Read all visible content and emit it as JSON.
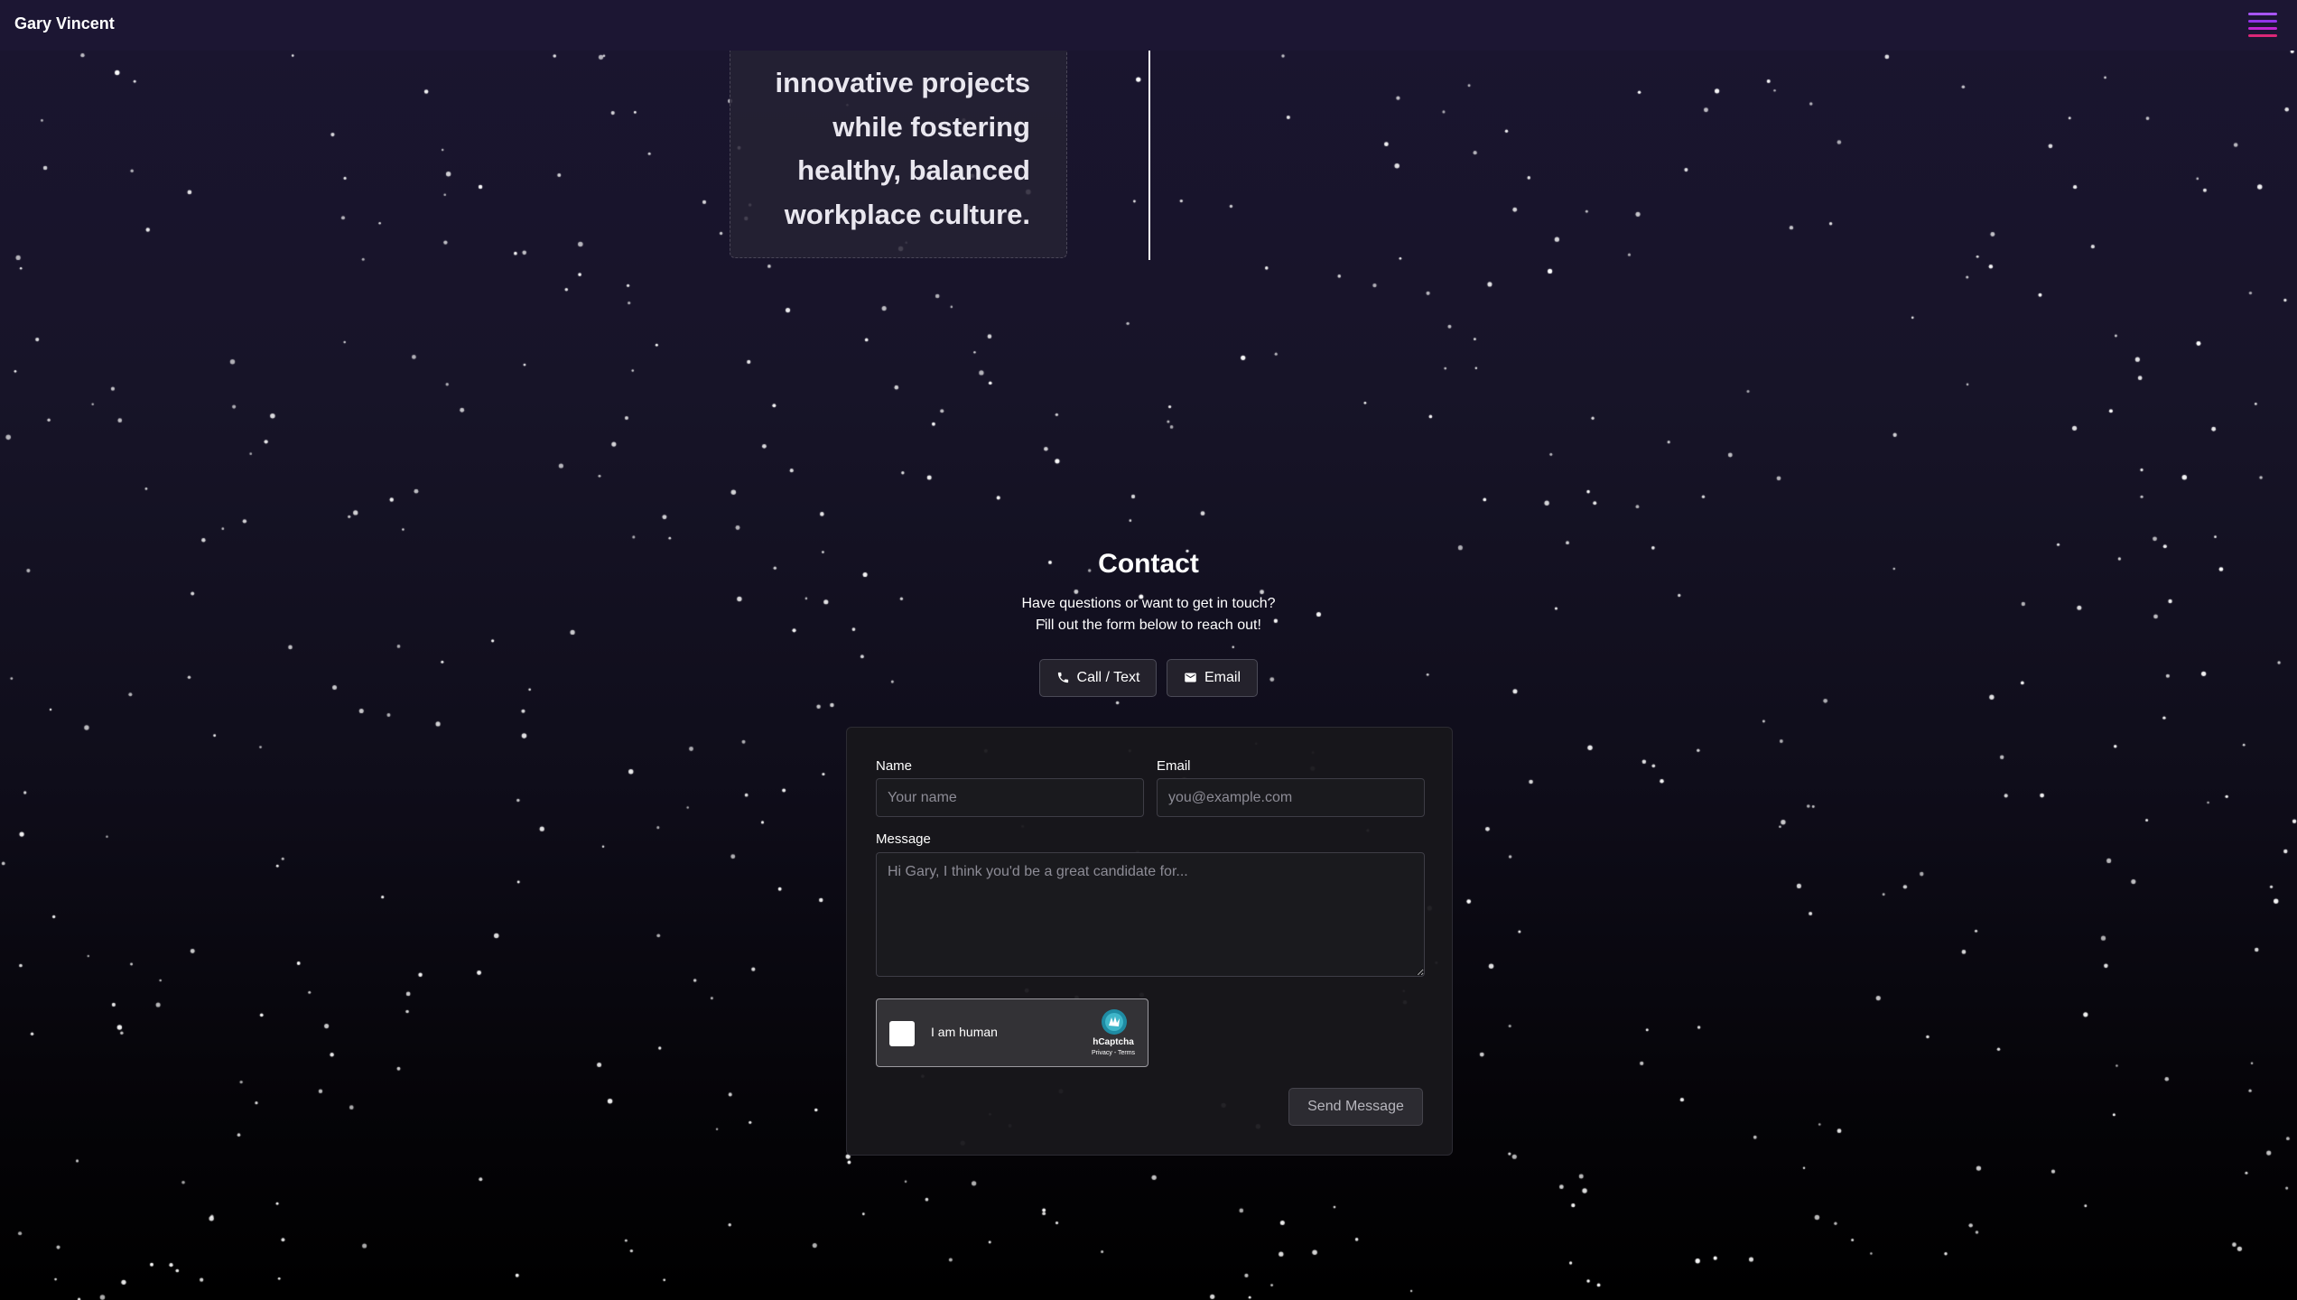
{
  "navbar": {
    "brand": "Gary Vincent",
    "menu_icon": "hamburger-menu-icon"
  },
  "quote": {
    "line1": "innovative projects",
    "line2": "while fostering",
    "line3": "healthy, balanced",
    "line4": "workplace culture."
  },
  "contact": {
    "title": "Contact",
    "subtitle_line1": "Have questions or want to get in touch?",
    "subtitle_line2": "Fill out the form below to reach out!",
    "call_button": "Call / Text",
    "call_icon": "phone-icon",
    "email_button": "Email",
    "email_icon": "envelope-icon"
  },
  "form": {
    "name_label": "Name",
    "name_placeholder": "Your name",
    "email_label": "Email",
    "email_placeholder": "you@example.com",
    "message_label": "Message",
    "message_placeholder": "Hi Gary, I think you'd be a great candidate for...",
    "captcha_label": "I am human",
    "captcha_brand": "hCaptcha",
    "captcha_links": "Privacy - Terms",
    "captcha_icon": "hcaptcha-logo-icon",
    "submit_label": "Send Message"
  },
  "colors": {
    "navbar_bg": "#1c1633",
    "menu_accent_top": "#a855f7",
    "menu_accent_bottom": "#db2777",
    "background_top": "#1a1530",
    "background_bottom": "#000000"
  }
}
